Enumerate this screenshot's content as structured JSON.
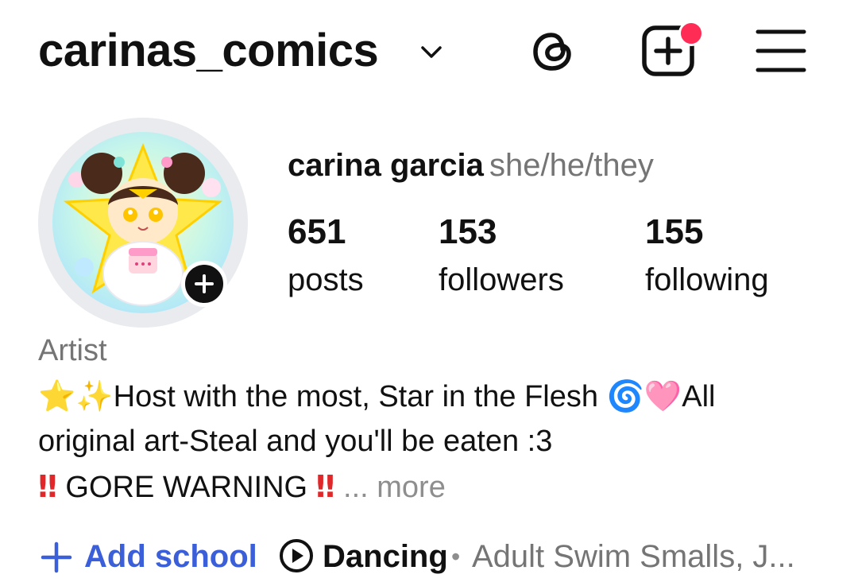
{
  "header": {
    "username": "carinas_comics",
    "icons": [
      "chevron-down-icon",
      "threads-icon",
      "create-post-icon",
      "menu-icon"
    ],
    "notification_dot_color": "#ff2d55"
  },
  "profile": {
    "full_name": "carina garcia",
    "pronouns": "she/he/they",
    "stats": [
      {
        "number": "651",
        "label": "posts"
      },
      {
        "number": "153",
        "label": "followers"
      },
      {
        "number": "155",
        "label": "following"
      }
    ]
  },
  "bio": {
    "category": "Artist",
    "line1_emoji_star": "⭐",
    "line1_emoji_sparkles": "✨",
    "line1_text": "Host with the most, Star in the Flesh ",
    "line1_emoji_cyclone": "🌀",
    "line1_emoji_heart": "🩷",
    "line1_tail": "All",
    "line2": "original art-Steal and you'll be eaten :3",
    "line3_emoji": "‼",
    "line3_text": " GORE WARNING ",
    "line3_emoji_end": "‼",
    "more": " ... more"
  },
  "links": {
    "add_school": "Add school",
    "music_title": "Dancing",
    "music_separator": "•",
    "music_artist": "Adult Swim Smalls, J..."
  },
  "colors": {
    "accent_blue": "#3b5fd9",
    "secondary_text": "#757575"
  }
}
